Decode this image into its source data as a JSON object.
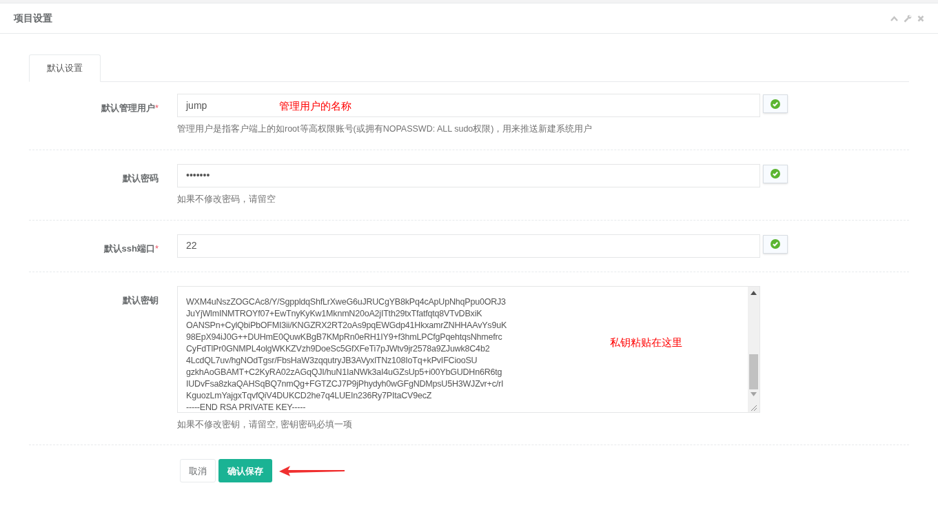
{
  "panel": {
    "title": "项目设置"
  },
  "tabs": [
    {
      "label": "默认设置",
      "selected": true
    }
  ],
  "fields": [
    {
      "kind": "text",
      "label": "默认管理用户",
      "required_mark": "*",
      "value": "jump",
      "note": "管理用户的名称",
      "help": "管理用户是指客户端上的如root等高权限账号(或拥有NOPASSWD: ALL sudo权限)，用来推送新建系统用户",
      "valid": true
    },
    {
      "kind": "text",
      "label": "默认密码",
      "value": "•••••••",
      "help": "如果不修改密码，请留空",
      "valid": true
    },
    {
      "kind": "text",
      "label": "默认ssh端口",
      "required_mark": "*",
      "value": "22",
      "valid": true
    },
    {
      "kind": "textarea",
      "label": "默认密钥",
      "lines": [
        "WXM4uNszZOGCAc8/Y/SgppldqShfLrXweG6uJRUCgYB8kPq4cApUpNhqPpu0ORJ3",
        "JuYjWlmINMTROYf07+EwTnyKyKw1MknmN20oA2jITth29txTfatfqtq8VTvDBxiK",
        "OANSPn+CylQbiPbOFMI3ii/KNGZRX2RT2oAs9pqEWGdp41HkxamrZNHHAAvYs9uK",
        "98EpX94iJ0G++DUHmE0QuwKBgB7KMpRn0eRH1IY9+f3hmLPCfgPqehtqsNhmefrc",
        "CyFdTlPr0GNMPL4olgWKKZVzh9DoeSc5GfXFeTi7pJWtv9jr2578a9ZJuwk8C4b2",
        "4LcdQL7uv/hgNOdTgsr/FbsHaW3zqqutryJB3AVyxlTNz108IoTq+kPvIFCiooSU",
        "gzkhAoGBAMT+C2KyRA02zAGqQJI/huN1IaNWk3aI4uGZsUp5+i00YbGUDHn6R6tg",
        "IUDvFsa8zkaQAHSqBQ7nmQg+FGTZCJ7P9jPhydyh0wGFgNDMpsU5H3WJZvr+c/rI",
        "KguozLmYajgxTqvfQiV4DUKCD2he7q4LUEIn236Ry7PItaCV9ecZ",
        "-----END RSA PRIVATE KEY-----"
      ],
      "note": "私钥粘贴在这里",
      "help": "如果不修改密钥，请留空, 密钥密码必填一项"
    }
  ],
  "buttons": [
    {
      "kind": "default",
      "label": "取消"
    },
    {
      "kind": "primary",
      "label": "确认保存"
    }
  ]
}
